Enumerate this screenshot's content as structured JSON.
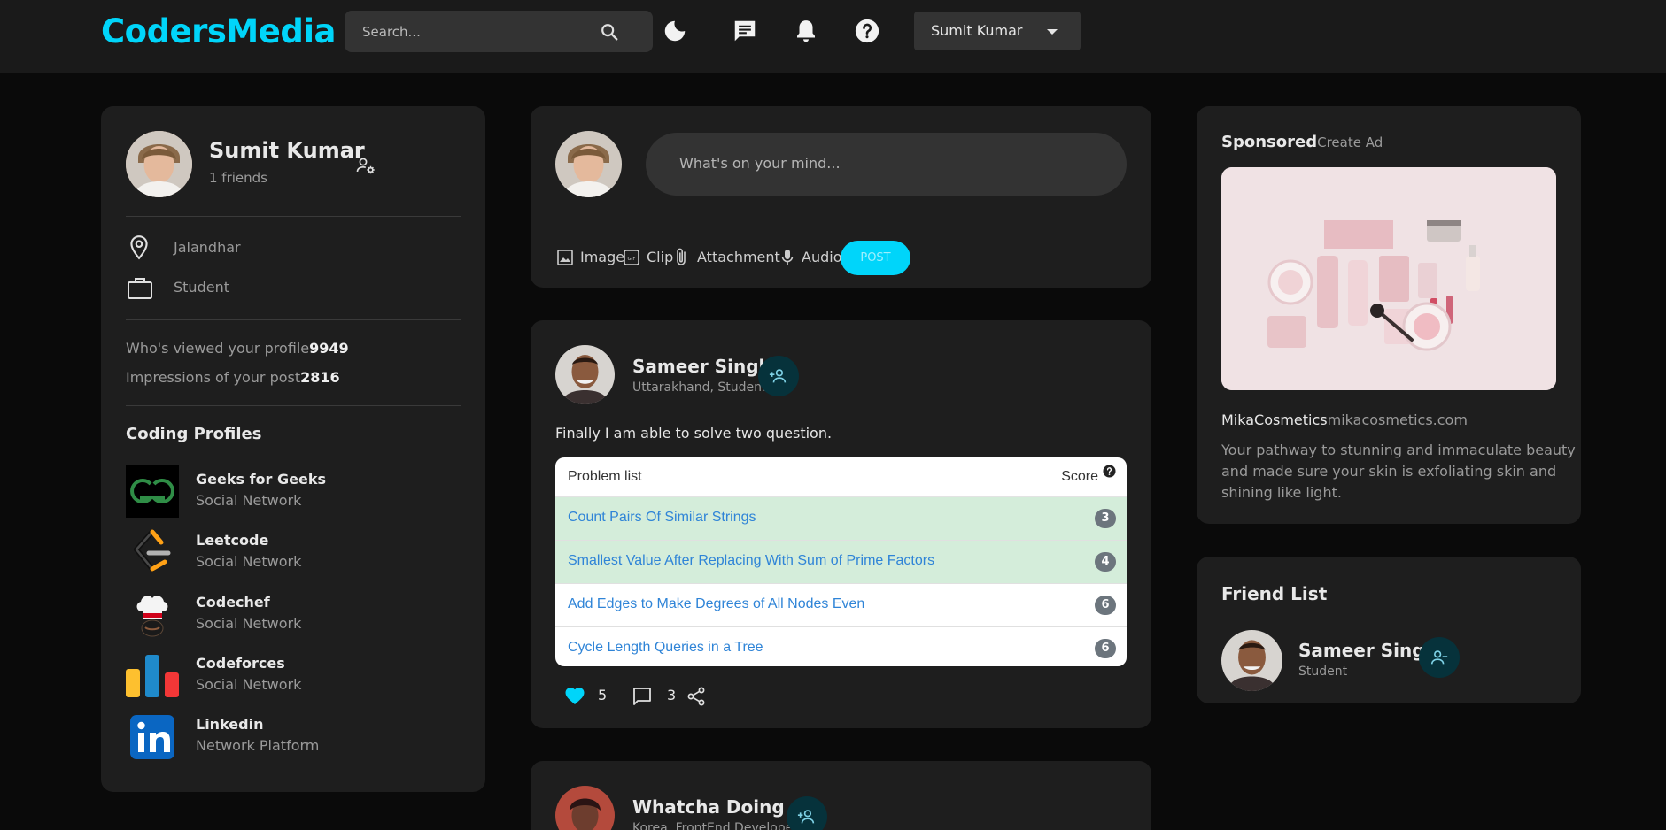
{
  "navbar": {
    "logo": "CodersMedia",
    "search_placeholder": "Search...",
    "icons": [
      "search-icon",
      "moon-icon",
      "message-icon",
      "bell-icon",
      "help-icon"
    ],
    "user_name": "Sumit Kumar"
  },
  "profile": {
    "name": "Sumit Kumar",
    "friends": "1 friends",
    "location": "Jalandhar",
    "occupation": "Student",
    "views_label": "Who's viewed your profile",
    "views_value": "9949",
    "impressions_label": "Impressions of your post",
    "impressions_value": "2816",
    "coding_title": "Coding Profiles",
    "coding_profiles": [
      {
        "name": "Geeks for Geeks",
        "type": "Social Network"
      },
      {
        "name": "Leetcode",
        "type": "Social Network"
      },
      {
        "name": "Codechef",
        "type": "Social Network"
      },
      {
        "name": "Codeforces",
        "type": "Social Network"
      },
      {
        "name": "Linkedin",
        "type": "Network Platform"
      }
    ]
  },
  "composer": {
    "placeholder": "What's on your mind...",
    "image": "Image",
    "clip": "Clip",
    "attachment": "Attachment",
    "audio": "Audio",
    "post": "POST"
  },
  "post": {
    "author": "Sameer Singh",
    "subtitle": "Uttarakhand, Student",
    "text": "Finally I am able to solve two question.",
    "list_header": "Problem list",
    "score_header": "Score",
    "problems": [
      {
        "name": "Count Pairs Of Similar Strings",
        "score": "3"
      },
      {
        "name": "Smallest Value After Replacing With Sum of Prime Factors",
        "score": "4"
      },
      {
        "name": "Add Edges to Make Degrees of All Nodes Even",
        "score": "6"
      },
      {
        "name": "Cycle Length Queries in a Tree",
        "score": "6"
      }
    ],
    "likes": "5",
    "comments": "3"
  },
  "post2": {
    "author": "Whatcha Doing",
    "subtitle": "Korea, FrontEnd Developer"
  },
  "sponsored": {
    "title": "Sponsored",
    "create_ad": "Create Ad",
    "brand": "MikaCosmetics",
    "url": "mikacosmetics.com",
    "description_lines": [
      "Your pathway to stunning and immaculate beauty",
      "and made sure your skin is exfoliating skin and",
      "shining like light."
    ]
  },
  "friend_list": {
    "title": "Friend List",
    "friends": [
      {
        "name": "Sameer Singh",
        "subtitle": "Student"
      }
    ]
  },
  "colors": {
    "accent": "#00d5fa",
    "card": "#1e1e1e",
    "navbar": "#1a1a1a",
    "background": "#0a0a0a"
  }
}
